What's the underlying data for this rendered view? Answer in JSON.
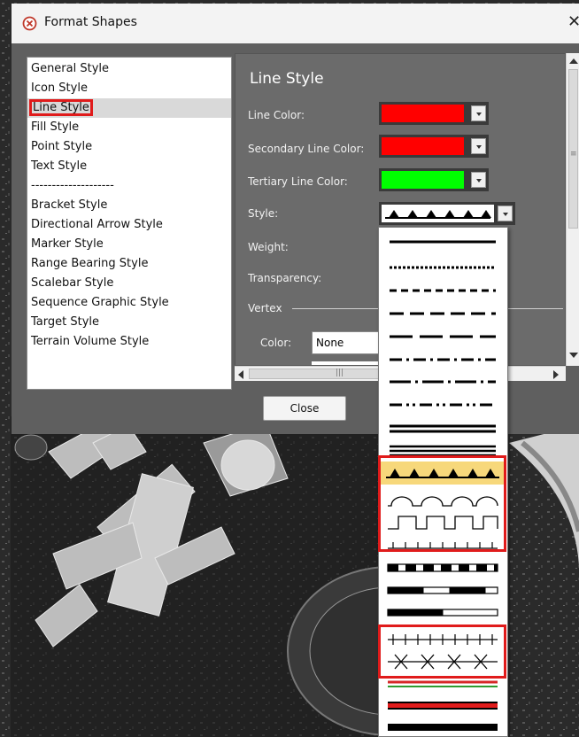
{
  "dialog": {
    "title": "Format Shapes",
    "close_glyph": "✕"
  },
  "style_list": [
    "General Style",
    "Icon Style",
    "Line Style",
    "Fill Style",
    "Point Style",
    "Text Style",
    "--------------------",
    "Bracket Style",
    "Directional Arrow Style",
    "Marker Style",
    "Range Bearing Style",
    "Scalebar Style",
    "Sequence Graphic Style",
    "Target Style",
    "Terrain Volume Style"
  ],
  "selected_style": "Line Style",
  "pane": {
    "title": "Line Style",
    "line_color_label": "Line Color:",
    "secondary_color_label": "Secondary Line Color:",
    "tertiary_color_label": "Tertiary Line Color:",
    "style_label": "Style:",
    "weight_label": "Weight:",
    "transparency_label": "Transparency:",
    "vertex_label": "Vertex",
    "vertex_color_label": "Color:",
    "vertex_color_value": "None"
  },
  "colors": {
    "line_color": "#ff0000",
    "secondary_line_color": "#ff0000",
    "tertiary_line_color": "#00ff00",
    "highlight": "#f7d87b",
    "annotation_box": "#e01b1b"
  },
  "scroll_grip": "|||",
  "close_label": "Close",
  "line_style_options": [
    "solid",
    "dotted",
    "dashed",
    "long-dash",
    "long-long-dash",
    "dash-dot",
    "dash-dot-long",
    "dash-dot-dot",
    "double",
    "triple",
    "triangles",
    "semicircles",
    "square-wave",
    "tick-marks",
    "dashed-double-band",
    "two-tone-band",
    "half-filled-band",
    "crossed-ticks",
    "x-marks",
    "red-green-double",
    "red-thick-bar",
    "black-thick-bar"
  ],
  "highlighted_option": "triangles"
}
